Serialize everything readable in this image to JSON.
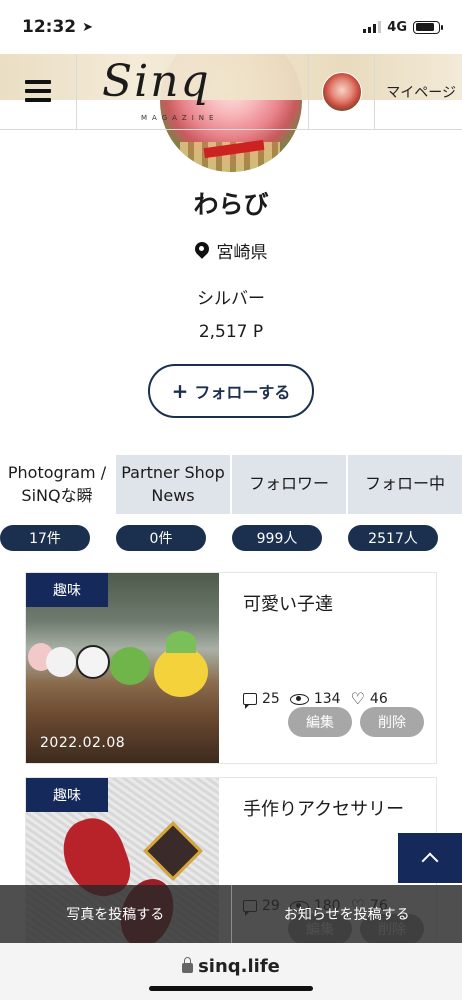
{
  "status_bar": {
    "time": "12:32",
    "network": "4G"
  },
  "header": {
    "logo_text": "Sinq",
    "logo_sub": "MAGAZINE",
    "mypage_label": "マイページ"
  },
  "profile": {
    "name": "わらび",
    "prefecture": "宮崎県",
    "rank": "シルバー",
    "points": "2,517 P",
    "follow_plus": "+",
    "follow_label": "フォローする"
  },
  "tabs": [
    {
      "label": "Photogram / SiNQな瞬",
      "count": "17件"
    },
    {
      "label": "Partner Shop News",
      "count": "0件"
    },
    {
      "label": "フォロワー",
      "count": "999人"
    },
    {
      "label": "フォロー中",
      "count": "2517人"
    }
  ],
  "posts": [
    {
      "tag": "趣味",
      "date": "2022.02.08",
      "title": "可愛い子達",
      "comments": "25",
      "views": "134",
      "likes": "46",
      "edit": "編集",
      "delete": "削除"
    },
    {
      "tag": "趣味",
      "date": "",
      "title": "手作りアクセサリー",
      "comments": "29",
      "views": "180",
      "likes": "76",
      "edit": "編集",
      "delete": "削除"
    }
  ],
  "post_bar": {
    "post_photo": "写真を投稿する",
    "post_news": "お知らせを投稿する"
  },
  "browser": {
    "url": "sinq.life"
  },
  "colors": {
    "navy": "#15295a",
    "tab_bg": "#dfe3ea",
    "pill_gray": "#a7a7a7"
  }
}
